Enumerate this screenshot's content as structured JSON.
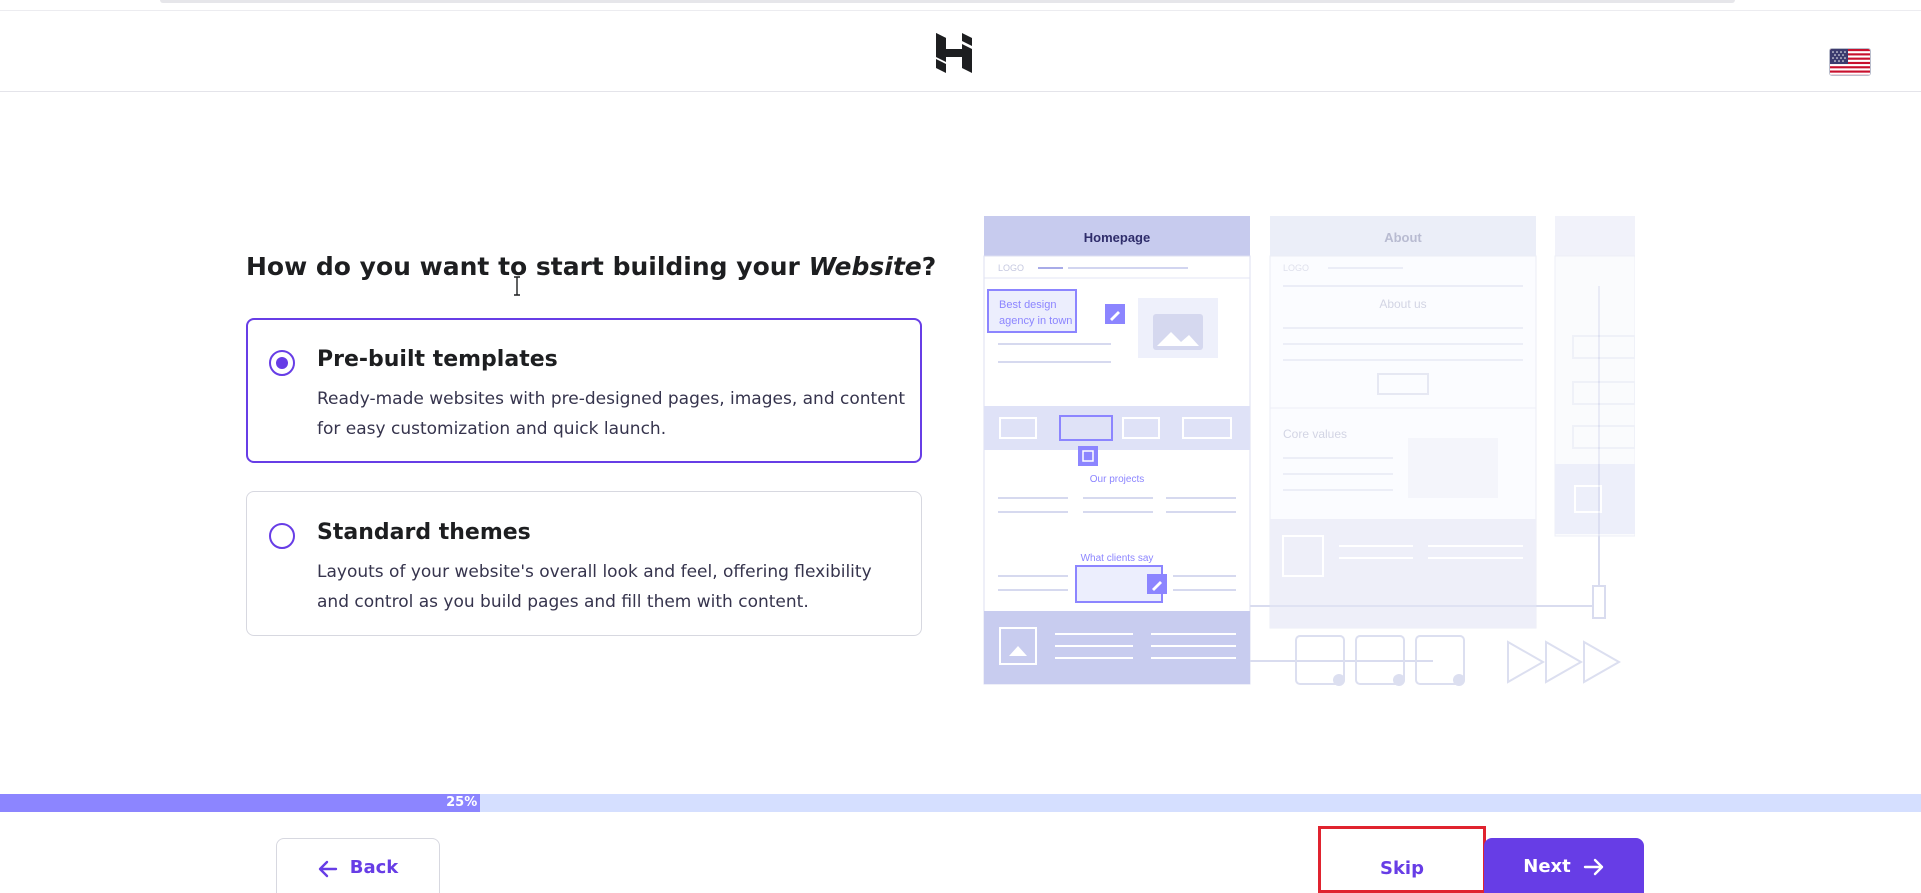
{
  "header": {
    "logo_icon": "hostinger-logo-icon",
    "language_icon": "us-flag-icon"
  },
  "question": {
    "prefix": "How do you want to start building your ",
    "emphasis": "Website",
    "suffix": "?"
  },
  "options": [
    {
      "title": "Pre-built templates",
      "description": "Ready-made websites with pre-designed pages, images, and content for easy customization and quick launch.",
      "selected": true
    },
    {
      "title": "Standard themes",
      "description": "Layouts of your website's overall look and feel, offering flexibility and control as you build pages and fill them with content.",
      "selected": false
    }
  ],
  "illustration": {
    "page1_title": "Homepage",
    "page2_title": "About",
    "logo_text": "LOGO",
    "hero_text_line1": "Best design",
    "hero_text_line2": "agency in town",
    "projects_label": "Our projects",
    "clients_label": "What clients say",
    "about_label": "About us",
    "core_values_label": "Core values"
  },
  "progress": {
    "label": "25%",
    "value": 0.25
  },
  "footer": {
    "back_label": "Back",
    "skip_label": "Skip",
    "next_label": "Next"
  },
  "colors": {
    "accent": "#673de6",
    "progress_fill": "#8c85ff",
    "progress_track": "#d5dfff",
    "highlight": "#e0232f"
  }
}
